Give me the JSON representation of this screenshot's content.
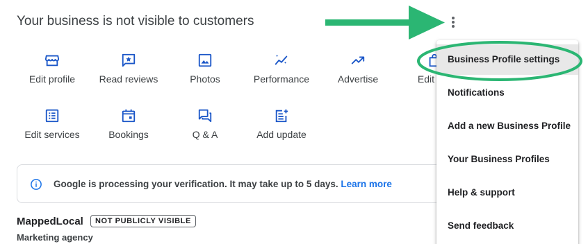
{
  "header": {
    "title": "Your business is not visible to customers",
    "more_icon": "more-vert-icon"
  },
  "actions_row1": [
    {
      "label": "Edit profile",
      "icon": "storefront-icon"
    },
    {
      "label": "Read reviews",
      "icon": "star-review-icon"
    },
    {
      "label": "Photos",
      "icon": "image-icon"
    },
    {
      "label": "Performance",
      "icon": "trending-icon"
    },
    {
      "label": "Advertise",
      "icon": "trending-up-icon"
    },
    {
      "label": "Edit pro",
      "icon": "bag-icon"
    }
  ],
  "actions_row2": [
    {
      "label": "Edit services",
      "icon": "list-icon"
    },
    {
      "label": "Bookings",
      "icon": "calendar-icon"
    },
    {
      "label": "Q & A",
      "icon": "forum-icon"
    },
    {
      "label": "Add update",
      "icon": "post-add-icon"
    }
  ],
  "banner": {
    "icon": "info-icon",
    "message": "Google is processing your verification. It may take up to 5 days.",
    "link": "Learn more"
  },
  "business": {
    "name": "MappedLocal",
    "badge": "NOT PUBLICLY VISIBLE",
    "category": "Marketing agency"
  },
  "menu": {
    "items": [
      {
        "label": "Business Profile settings",
        "highlighted": true
      },
      {
        "label": "Notifications"
      },
      {
        "label": "Add a new Business Profile"
      },
      {
        "label": "Your Business Profiles"
      },
      {
        "label": "Help & support"
      },
      {
        "label": "Send feedback"
      }
    ]
  },
  "annotation": {
    "arrow_color": "#2bb673",
    "circle_color": "#2bb673"
  },
  "colors": {
    "icon_blue": "#1a56c8",
    "link_blue": "#1a73e8"
  }
}
